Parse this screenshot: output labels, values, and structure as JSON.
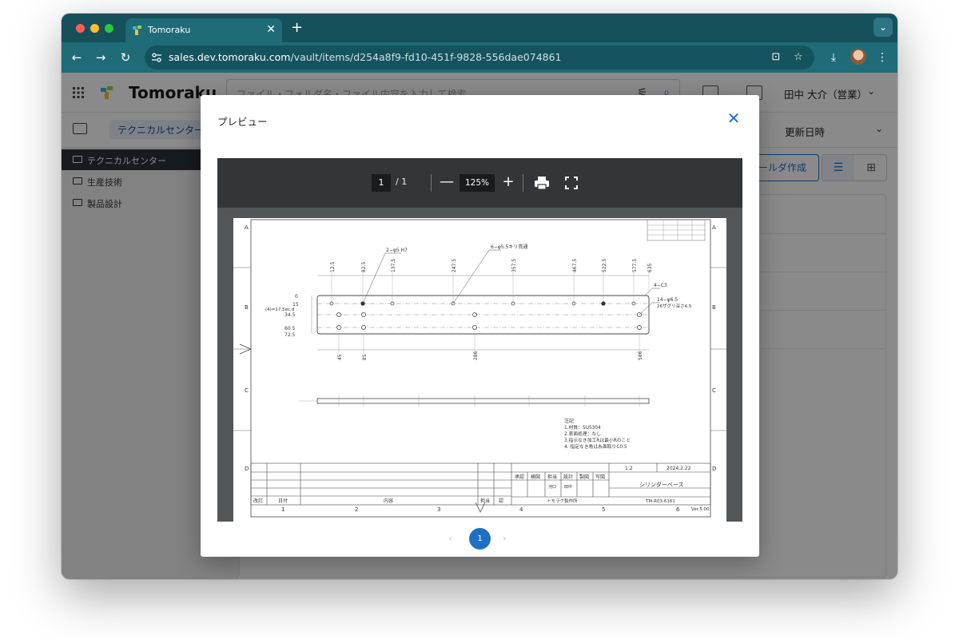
{
  "browser": {
    "tab_title": "Tomoraku",
    "url_host": "sales.dev.tomoraku.com",
    "url_path": "/vault/items/d254a8f9-fd10-451f-9828-556dae074861",
    "new_tab_symbol": "+",
    "close_symbol": "✕",
    "tab_menu_symbol": "⌄"
  },
  "app": {
    "name": "Tomoraku",
    "search_placeholder": "ファイル・フォルダ名・ファイル内容を入力して検索",
    "user_name": "田中 大介（営業）",
    "breadcrumb": "テクニカルセンター",
    "sort_label": "更新日時",
    "create_button": "ールダ作成",
    "sidebar_items": [
      "テクニカルセンター",
      "生産技術",
      "製品設計"
    ]
  },
  "modal": {
    "title": "プレビュー",
    "close_symbol": "✕"
  },
  "viewer": {
    "page_current": "1",
    "page_total": "/  1",
    "zoom": "125%",
    "minus": "—",
    "plus": "+"
  },
  "drawing": {
    "row_letters": [
      "A",
      "B",
      "C",
      "D"
    ],
    "col_numbers": [
      "1",
      "2",
      "3",
      "4",
      "5",
      "6"
    ],
    "top_dims": [
      "12.5",
      "82.5",
      "137.5",
      "247.5",
      "357.5",
      "467.5",
      "522.5",
      "577.5",
      "635"
    ],
    "left_dims": [
      "0",
      "15",
      "34.5",
      "60.5",
      "72.5"
    ],
    "bottom_dims": [
      "45",
      "85",
      "286",
      "586"
    ],
    "callout_1": "2−φ5 H7",
    "callout_2": "6−φ5.5キリ貫通",
    "callout_3": "4−C3",
    "callout_4": "14−φ6.5",
    "callout_5": "26ザグリ深さ4.5",
    "left_note": "(4)=17.5ec.d",
    "notes_title": "注記",
    "notes": [
      "1.材質：SUS304",
      "2.表面処理：なし",
      "3.指示なき加工Rは最小Rのこと",
      "4. 指定なき角は糸面取りC0.5"
    ],
    "scale": "1:2",
    "date": "2024.2.22",
    "part_name": "シリンダーベース",
    "approval_headers": [
      "承認",
      "検図",
      "担当",
      "設計",
      "製図",
      "写図"
    ],
    "stamp_1": "河口",
    "stamp_2": "田中",
    "footer_labels": [
      "改訂",
      "日付",
      "内容",
      "担当",
      "認"
    ],
    "company": "トモラク製作所",
    "drawing_no": "TM-R03-6161",
    "version": "Ver.5.00"
  },
  "pagination": {
    "prev": "‹",
    "current": "1",
    "next": "›"
  },
  "colors": {
    "browser_frame": "#16505b",
    "toolbar": "#1f6b78",
    "accent": "#1f6fc5",
    "viewer_bar": "#323639"
  }
}
